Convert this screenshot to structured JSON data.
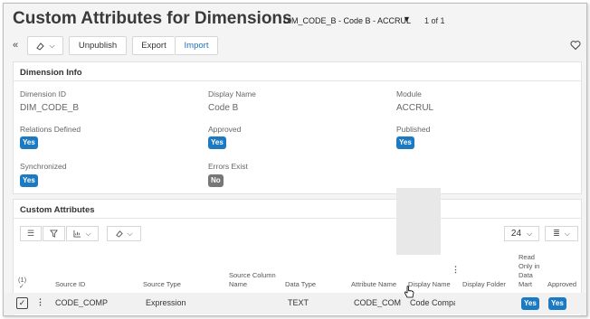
{
  "header": {
    "title": "Custom Attributes for Dimensions",
    "dimension_select": "DIM_CODE_B - Code B - ACCRUL",
    "page_count": "1 of 1"
  },
  "toolbar": {
    "unpublish_label": "Unpublish",
    "export_label": "Export",
    "import_label": "Import"
  },
  "dimension_info": {
    "title": "Dimension Info",
    "fields": {
      "dimension_id": {
        "label": "Dimension ID",
        "value": "DIM_CODE_B"
      },
      "display_name": {
        "label": "Display Name",
        "value": "Code B"
      },
      "module": {
        "label": "Module",
        "value": "ACCRUL"
      },
      "relations_defined": {
        "label": "Relations Defined",
        "value": "Yes"
      },
      "approved": {
        "label": "Approved",
        "value": "Yes"
      },
      "published": {
        "label": "Published",
        "value": "Yes"
      },
      "synchronized": {
        "label": "Synchronized",
        "value": "Yes"
      },
      "errors_exist": {
        "label": "Errors Exist",
        "value": "No"
      }
    }
  },
  "custom_attributes": {
    "title": "Custom Attributes",
    "page_size": "24",
    "selection_count": "(1)",
    "columns": {
      "source_id": "Source ID",
      "source_type": "Source Type",
      "source_column_name": "Source Column Name",
      "data_type": "Data Type",
      "attribute_name": "Attribute Name",
      "display_name": "Display Name",
      "display_folder": "Display Folder",
      "read_only": "Read Only in Data Mart",
      "approved": "Approved"
    },
    "rows": [
      {
        "source_id": "CODE_COMP",
        "source_type": "Expression",
        "source_column_name": "",
        "data_type": "TEXT",
        "attribute_name": "CODE_COMP",
        "display_name": "Code Compar",
        "display_folder": "",
        "read_only": "Yes",
        "approved": "Yes"
      }
    ]
  },
  "colors": {
    "accent": "#1b7ac2",
    "badge_gray": "#777777",
    "title_text": "#3a3a3a"
  }
}
